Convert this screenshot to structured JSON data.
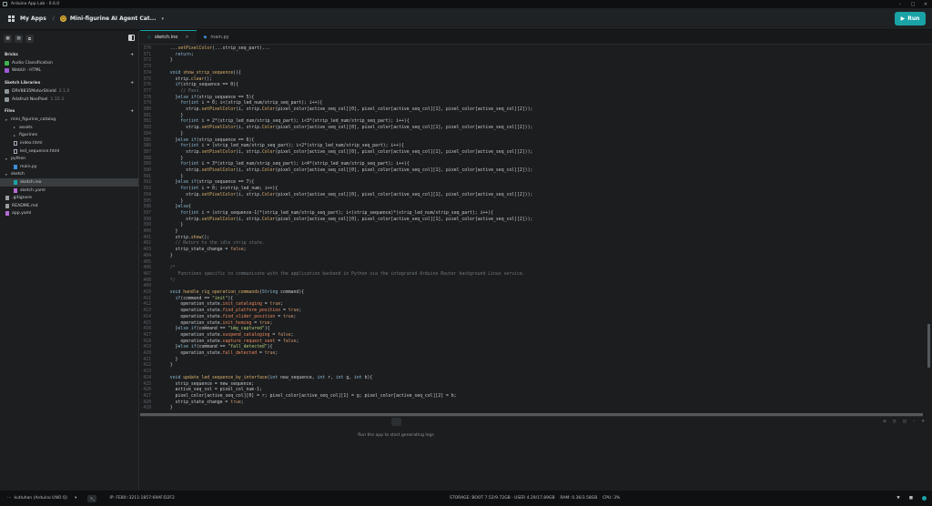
{
  "window": {
    "title": "Arduino App Lab - 0.6.0"
  },
  "topbar": {
    "my_apps": "My Apps",
    "separator": "/",
    "app_name": "Mini-figurine AI Agent Cat...",
    "emoji": "😊",
    "run_label": "Run"
  },
  "sidebar": {
    "bricks_header": "Bricks",
    "bricks": [
      {
        "label": "Audio Classification",
        "color": "#3fb34f"
      },
      {
        "label": "WebUI - HTML",
        "color": "#a15bd6"
      }
    ],
    "libraries_header": "Sketch Libraries",
    "libraries": [
      {
        "label": "DRV8835MotorShield",
        "version": "2.1.0"
      },
      {
        "label": "Adafruit NeoPixel",
        "version": "1.15.3"
      }
    ],
    "files_header": "Files",
    "files": [
      {
        "label": "mini_figurine_catalog",
        "type": "folder",
        "indent": 0,
        "open": true
      },
      {
        "label": "assets",
        "type": "folder",
        "indent": 1,
        "open": false
      },
      {
        "label": "figurines",
        "type": "folder",
        "indent": 1,
        "open": false
      },
      {
        "label": "index.html",
        "type": "file",
        "indent": 1
      },
      {
        "label": "led_sequence.html",
        "type": "file",
        "indent": 1
      },
      {
        "label": "python",
        "type": "folder",
        "indent": 0,
        "open": true
      },
      {
        "label": "main.py",
        "type": "py",
        "indent": 1
      },
      {
        "label": "sketch",
        "type": "folder",
        "indent": 0,
        "open": true
      },
      {
        "label": "sketch.ino",
        "type": "ino",
        "indent": 1,
        "selected": true
      },
      {
        "label": "sketch.yaml",
        "type": "yaml",
        "indent": 1
      },
      {
        "label": ".gitignore",
        "type": "git",
        "indent": 0
      },
      {
        "label": "README.md",
        "type": "md",
        "indent": 0
      },
      {
        "label": "app.yaml",
        "type": "yaml",
        "indent": 0
      }
    ]
  },
  "tabs": [
    {
      "label": "sketch.ino",
      "active": true
    },
    {
      "label": "main.py",
      "active": false
    }
  ],
  "code": {
    "lines": [
      {
        "n": "370",
        "t": "  ...setPixelColor(...strip_seq_part)..."
      },
      {
        "n": "371",
        "t": "    return;"
      },
      {
        "n": "372",
        "t": "  }"
      },
      {
        "n": "373",
        "t": ""
      },
      {
        "n": "374",
        "t": "  void show_strip_sequence(){"
      },
      {
        "n": "375",
        "t": "    strip.clear();"
      },
      {
        "n": "376",
        "t": "    if(strip_sequence == 0){"
      },
      {
        "n": "377",
        "t": "      // Pass."
      },
      {
        "n": "378",
        "t": "    }else if(strip_sequence == 5){"
      },
      {
        "n": "379",
        "t": "      for(int i = 0; i<(strip_led_num/strip_seq_part); i++){"
      },
      {
        "n": "380",
        "t": "        strip.setPixelColor(i, strip.Color(pixel_color[active_seq_col][0], pixel_color[active_seq_col][1], pixel_color[active_seq_col][2]));"
      },
      {
        "n": "381",
        "t": "      }"
      },
      {
        "n": "382",
        "t": "      for(int i = 2*(strip_led_num/strip_seq_part); i<3*(strip_led_num/strip_seq_part); i++){"
      },
      {
        "n": "383",
        "t": "        strip.setPixelColor(i, strip.Color(pixel_color[active_seq_col][0], pixel_color[active_seq_col][1], pixel_color[active_seq_col][2]));"
      },
      {
        "n": "384",
        "t": "      }"
      },
      {
        "n": "385",
        "t": "    }else if(strip_sequence == 6){"
      },
      {
        "n": "386",
        "t": "      for(int i = (strip_led_num/strip_seq_part); i<2*(strip_led_num/strip_seq_part); i++){"
      },
      {
        "n": "387",
        "t": "        strip.setPixelColor(i, strip.Color(pixel_color[active_seq_col][0], pixel_color[active_seq_col][1], pixel_color[active_seq_col][2]));"
      },
      {
        "n": "388",
        "t": "      }"
      },
      {
        "n": "389",
        "t": "      for(int i = 3*(strip_led_num/strip_seq_part); i<4*(strip_led_num/strip_seq_part); i++){"
      },
      {
        "n": "390",
        "t": "        strip.setPixelColor(i, strip.Color(pixel_color[active_seq_col][0], pixel_color[active_seq_col][1], pixel_color[active_seq_col][2]));"
      },
      {
        "n": "391",
        "t": "      }"
      },
      {
        "n": "392",
        "t": "    }else if(strip_sequence == 7){"
      },
      {
        "n": "393",
        "t": "      for(int i = 0; i<strip_led_num; i++){"
      },
      {
        "n": "394",
        "t": "        strip.setPixelColor(i, strip.Color(pixel_color[active_seq_col][0], pixel_color[active_seq_col][1], pixel_color[active_seq_col][2]));"
      },
      {
        "n": "395",
        "t": "      }"
      },
      {
        "n": "396",
        "t": "    }else{"
      },
      {
        "n": "397",
        "t": "      for(int i = (strip_sequence-1)*(strip_led_num/strip_seq_part); i<(strip_sequence)*(strip_led_num/strip_seq_part); i++){"
      },
      {
        "n": "398",
        "t": "        strip.setPixelColor(i, strip.Color(pixel_color[active_seq_col][0], pixel_color[active_seq_col][1], pixel_color[active_seq_col][2]));"
      },
      {
        "n": "399",
        "t": "      }"
      },
      {
        "n": "400",
        "t": "    }"
      },
      {
        "n": "401",
        "t": "    strip.show();"
      },
      {
        "n": "402",
        "t": "    // Return to the idle strip state."
      },
      {
        "n": "403",
        "t": "    strip_state_change = false;"
      },
      {
        "n": "404",
        "t": "  }"
      },
      {
        "n": "405",
        "t": ""
      },
      {
        "n": "406",
        "t": "  /*"
      },
      {
        "n": "407",
        "t": "     Functions specific to communicate with the application backend in Python via the integrated Arduino Router background Linux service."
      },
      {
        "n": "408",
        "t": "  */"
      },
      {
        "n": "409",
        "t": ""
      },
      {
        "n": "410",
        "t": "  void handle_rig_operation_commands(String command){"
      },
      {
        "n": "411",
        "t": "    if(command == \"init\"){"
      },
      {
        "n": "412",
        "t": "      operation_state.init_cataloging = true;"
      },
      {
        "n": "413",
        "t": "      operation_state.find_platform_position = true;"
      },
      {
        "n": "414",
        "t": "      operation_state.find_slider_position = true;"
      },
      {
        "n": "415",
        "t": "      operation_state.init_homing = true;"
      },
      {
        "n": "416",
        "t": "    }else if(command == \"img_captured\"){"
      },
      {
        "n": "417",
        "t": "      operation_state.suspend_cataloging = false;"
      },
      {
        "n": "418",
        "t": "      operation_state.capture_request_sent = false;"
      },
      {
        "n": "419",
        "t": "    }else if(command == \"fall_detected\"){"
      },
      {
        "n": "420",
        "t": "      operation_state.fall_detected = true;"
      },
      {
        "n": "421",
        "t": "    }"
      },
      {
        "n": "422",
        "t": "  }"
      },
      {
        "n": "423",
        "t": ""
      },
      {
        "n": "424",
        "t": "  void update_led_sequence_by_interface(int new_sequence, int r, int g, int b){"
      },
      {
        "n": "425",
        "t": "    strip_sequence = new_sequence;"
      },
      {
        "n": "426",
        "t": "    active_seq_col = pixel_col_num-1;"
      },
      {
        "n": "427",
        "t": "    pixel_color[active_seq_col][0] = r; pixel_color[active_seq_col][1] = g; pixel_color[active_seq_col][2] = b;"
      },
      {
        "n": "428",
        "t": "    strip_state_change = true;"
      },
      {
        "n": "429",
        "t": "  }"
      }
    ]
  },
  "console": {
    "message": "Run the app to start generating logs"
  },
  "statusbar": {
    "board": "kutluhan (Arduino UNO Q)",
    "ip": "IP: FE80::3211:1857:69AF:D2F2",
    "storage": "STORAGE: BOOT 7.52/9.72GB · USER 4.29/17.89GB",
    "ram": "RAM: 0.36/3.58GB",
    "cpu": "CPU: 3%"
  },
  "colors": {
    "accent": "#19a3a7"
  }
}
